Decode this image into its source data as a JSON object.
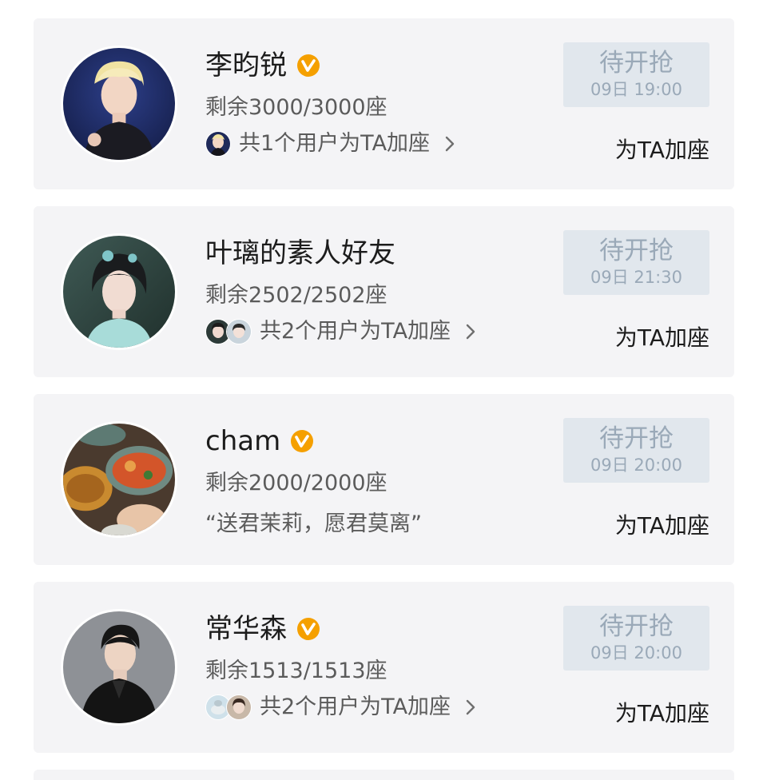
{
  "cards": [
    {
      "name": "李昀锐",
      "verified": true,
      "seats": "剩余3000/3000座",
      "helpers": "共1个用户为TA加座",
      "status": "待开抢",
      "time": "09日 19:00",
      "action": "为TA加座"
    },
    {
      "name": "叶璃的素人好友",
      "verified": false,
      "seats": "剩余2502/2502座",
      "helpers": "共2个用户为TA加座",
      "status": "待开抢",
      "time": "09日 21:30",
      "action": "为TA加座"
    },
    {
      "name": "cham",
      "verified": true,
      "seats": "剩余2000/2000座",
      "quote": "“送君茉莉，愿君莫离”",
      "status": "待开抢",
      "time": "09日 20:00",
      "action": "为TA加座"
    },
    {
      "name": "常华森",
      "verified": true,
      "seats": "剩余1513/1513座",
      "helpers": "共2个用户为TA加座",
      "status": "待开抢",
      "time": "09日 20:00",
      "action": "为TA加座"
    }
  ],
  "colors": {
    "card_bg": "#f4f4f6",
    "status_bg": "#e1e7ed",
    "status_text": "#9aa9b8",
    "verified_badge": "#f5a000"
  }
}
